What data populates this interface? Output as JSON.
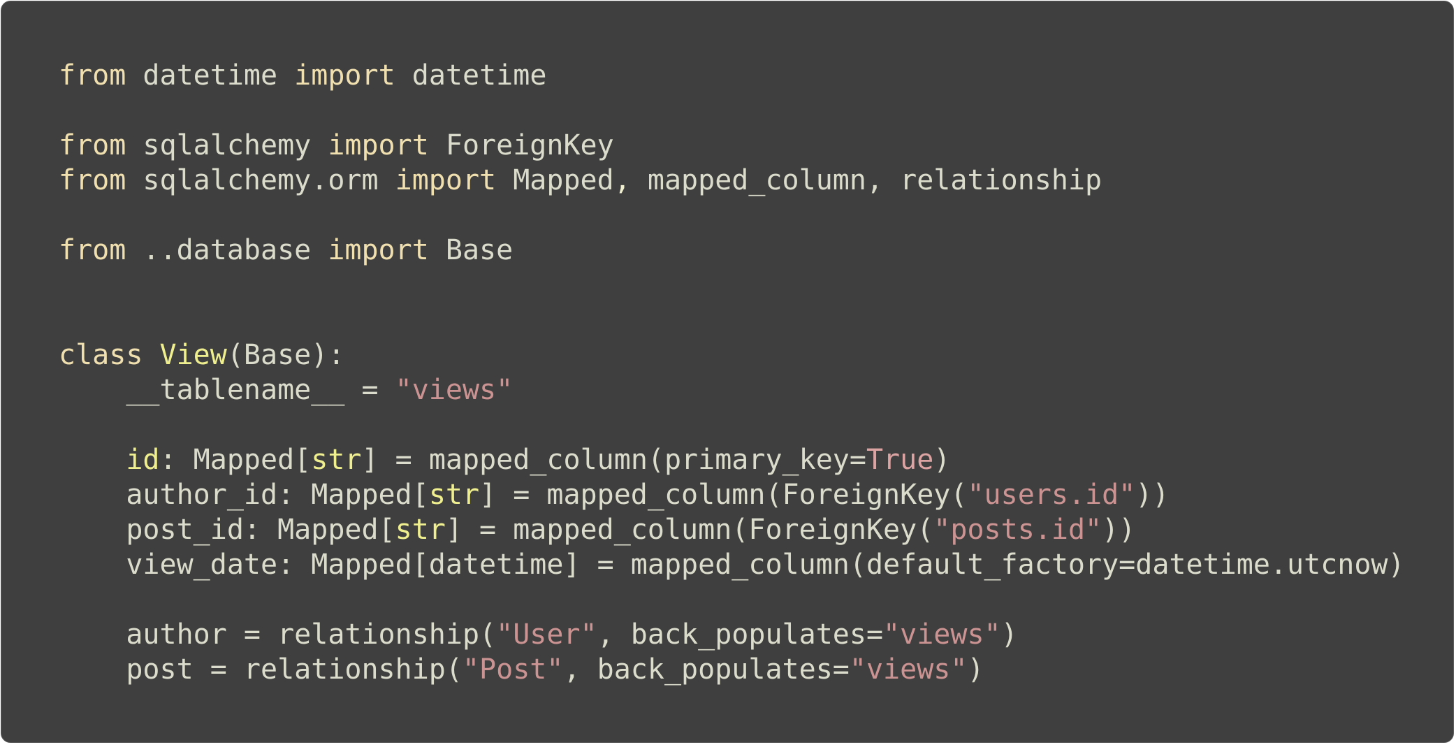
{
  "theme": {
    "background": "#3f3f3f",
    "colors": {
      "keyword": "#f0dfaf",
      "text": "#dcdccc",
      "classname": "#efef8f",
      "builtin": "#efef8f",
      "string": "#cc9393",
      "constant": "#dca3a3",
      "operator": "#f0efd0"
    }
  },
  "code": {
    "language": "python",
    "lines": [
      [
        {
          "t": "keyword",
          "s": "from"
        },
        {
          "t": "text",
          "s": " datetime "
        },
        {
          "t": "keyword",
          "s": "import"
        },
        {
          "t": "text",
          "s": " datetime"
        }
      ],
      [],
      [
        {
          "t": "keyword",
          "s": "from"
        },
        {
          "t": "text",
          "s": " sqlalchemy "
        },
        {
          "t": "keyword",
          "s": "import"
        },
        {
          "t": "text",
          "s": " ForeignKey"
        }
      ],
      [
        {
          "t": "keyword",
          "s": "from"
        },
        {
          "t": "text",
          "s": " sqlalchemy.orm "
        },
        {
          "t": "keyword",
          "s": "import"
        },
        {
          "t": "text",
          "s": " Mapped"
        },
        {
          "t": "operator",
          "s": ","
        },
        {
          "t": "text",
          "s": " mapped_column, relationship"
        }
      ],
      [],
      [
        {
          "t": "keyword",
          "s": "from"
        },
        {
          "t": "text",
          "s": " ..database "
        },
        {
          "t": "keyword",
          "s": "import"
        },
        {
          "t": "text",
          "s": " Base"
        }
      ],
      [],
      [],
      [
        {
          "t": "keyword",
          "s": "class"
        },
        {
          "t": "text",
          "s": " "
        },
        {
          "t": "classname",
          "s": "View"
        },
        {
          "t": "text",
          "s": "(Base):"
        }
      ],
      [
        {
          "t": "text",
          "s": "    __tablename__ = "
        },
        {
          "t": "string",
          "s": "\"views\""
        }
      ],
      [],
      [
        {
          "t": "text",
          "s": "    "
        },
        {
          "t": "builtin",
          "s": "id"
        },
        {
          "t": "text",
          "s": ": Mapped["
        },
        {
          "t": "builtin",
          "s": "str"
        },
        {
          "t": "text",
          "s": "] = mapped_column(primary_key="
        },
        {
          "t": "constant",
          "s": "True"
        },
        {
          "t": "text",
          "s": ")"
        }
      ],
      [
        {
          "t": "text",
          "s": "    author_id: Mapped["
        },
        {
          "t": "builtin",
          "s": "str"
        },
        {
          "t": "text",
          "s": "] = mapped_column(ForeignKey("
        },
        {
          "t": "string",
          "s": "\"users.id\""
        },
        {
          "t": "text",
          "s": "))"
        }
      ],
      [
        {
          "t": "text",
          "s": "    post_id: Mapped["
        },
        {
          "t": "builtin",
          "s": "str"
        },
        {
          "t": "text",
          "s": "] = mapped_column(ForeignKey("
        },
        {
          "t": "string",
          "s": "\"posts.id\""
        },
        {
          "t": "text",
          "s": "))"
        }
      ],
      [
        {
          "t": "text",
          "s": "    view_date: Mapped[datetime] = mapped_column(default_factory=datetime.utcnow)"
        }
      ],
      [],
      [
        {
          "t": "text",
          "s": "    author = relationship("
        },
        {
          "t": "string",
          "s": "\"User\""
        },
        {
          "t": "text",
          "s": ", back_populates="
        },
        {
          "t": "string",
          "s": "\"views\""
        },
        {
          "t": "text",
          "s": ")"
        }
      ],
      [
        {
          "t": "text",
          "s": "    post = relationship("
        },
        {
          "t": "string",
          "s": "\"Post\""
        },
        {
          "t": "text",
          "s": ", back_populates="
        },
        {
          "t": "string",
          "s": "\"views\""
        },
        {
          "t": "text",
          "s": ")"
        }
      ]
    ]
  }
}
